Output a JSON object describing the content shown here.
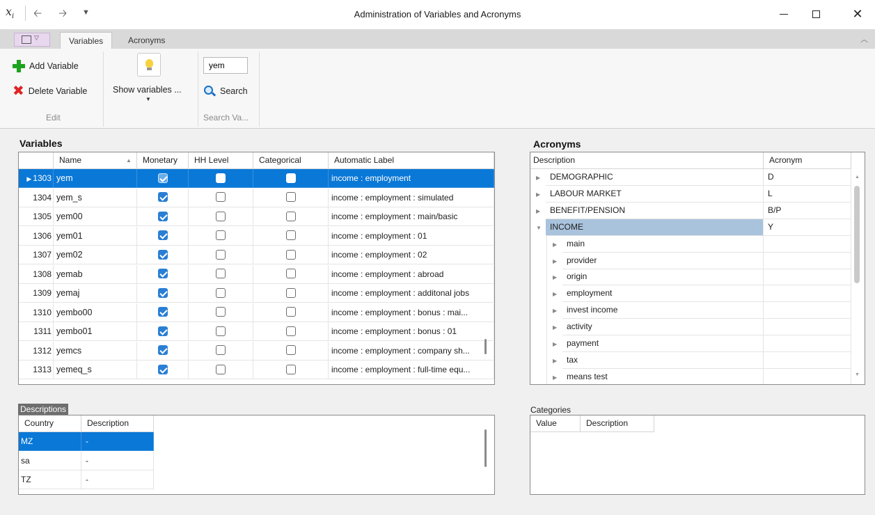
{
  "window": {
    "title": "Administration of Variables and Acronyms",
    "app_icon": "xi-icon"
  },
  "ribbon": {
    "tabs": [
      "Variables",
      "Acronyms"
    ],
    "active_tab": "Variables",
    "add_variable": "Add Variable",
    "delete_variable": "Delete Variable",
    "group_edit": "Edit",
    "show_variables": "Show variables ...",
    "search_value": "yem",
    "search_label": "Search",
    "group_search": "Search Va..."
  },
  "variables": {
    "heading": "Variables",
    "columns": [
      "Name",
      "Monetary",
      "HH Level",
      "Categorical",
      "Automatic Label"
    ],
    "rows": [
      {
        "id": "1303",
        "name": "yem",
        "monetary": true,
        "hh": false,
        "cat": false,
        "label": "income : employment",
        "selected": true
      },
      {
        "id": "1304",
        "name": "yem_s",
        "monetary": true,
        "hh": false,
        "cat": false,
        "label": "income : employment : simulated"
      },
      {
        "id": "1305",
        "name": "yem00",
        "monetary": true,
        "hh": false,
        "cat": false,
        "label": "income : employment : main/basic"
      },
      {
        "id": "1306",
        "name": "yem01",
        "monetary": true,
        "hh": false,
        "cat": false,
        "label": "income : employment : 01"
      },
      {
        "id": "1307",
        "name": "yem02",
        "monetary": true,
        "hh": false,
        "cat": false,
        "label": "income : employment : 02"
      },
      {
        "id": "1308",
        "name": "yemab",
        "monetary": true,
        "hh": false,
        "cat": false,
        "label": "income : employment : abroad"
      },
      {
        "id": "1309",
        "name": "yemaj",
        "monetary": true,
        "hh": false,
        "cat": false,
        "label": "income : employment : additonal jobs"
      },
      {
        "id": "1310",
        "name": "yembo00",
        "monetary": true,
        "hh": false,
        "cat": false,
        "label": "income : employment : bonus : mai..."
      },
      {
        "id": "1311",
        "name": "yembo01",
        "monetary": true,
        "hh": false,
        "cat": false,
        "label": "income : employment : bonus : 01"
      },
      {
        "id": "1312",
        "name": "yemcs",
        "monetary": true,
        "hh": false,
        "cat": false,
        "label": "income : employment : company sh..."
      },
      {
        "id": "1313",
        "name": "yemeq_s",
        "monetary": true,
        "hh": false,
        "cat": false,
        "label": "income : employment : full-time equ..."
      }
    ]
  },
  "acronyms": {
    "heading": "Acronyms",
    "columns": [
      "Description",
      "Acronym"
    ],
    "rows": [
      {
        "desc": "DEMOGRAPHIC",
        "acr": "D",
        "level": 0,
        "expanded": false
      },
      {
        "desc": "LABOUR MARKET",
        "acr": "L",
        "level": 0,
        "expanded": false
      },
      {
        "desc": "BENEFIT/PENSION",
        "acr": "B/P",
        "level": 0,
        "expanded": false
      },
      {
        "desc": "INCOME",
        "acr": "Y",
        "level": 0,
        "expanded": true,
        "highlight": true
      },
      {
        "desc": "main",
        "acr": "",
        "level": 1
      },
      {
        "desc": "provider",
        "acr": "",
        "level": 1
      },
      {
        "desc": "origin",
        "acr": "",
        "level": 1
      },
      {
        "desc": "employment",
        "acr": "",
        "level": 1
      },
      {
        "desc": "invest income",
        "acr": "",
        "level": 1
      },
      {
        "desc": "activity",
        "acr": "",
        "level": 1
      },
      {
        "desc": "payment",
        "acr": "",
        "level": 1
      },
      {
        "desc": "tax",
        "acr": "",
        "level": 1
      },
      {
        "desc": "means test",
        "acr": "",
        "level": 1
      }
    ]
  },
  "descriptions": {
    "heading": "Descriptions",
    "columns": [
      "Country",
      "Description"
    ],
    "rows": [
      {
        "country": "MZ",
        "desc": "-",
        "selected": true
      },
      {
        "country": "sa",
        "desc": "-"
      },
      {
        "country": "TZ",
        "desc": "-"
      }
    ]
  },
  "categories": {
    "heading": "Categories",
    "columns": [
      "Value",
      "Description"
    ]
  }
}
